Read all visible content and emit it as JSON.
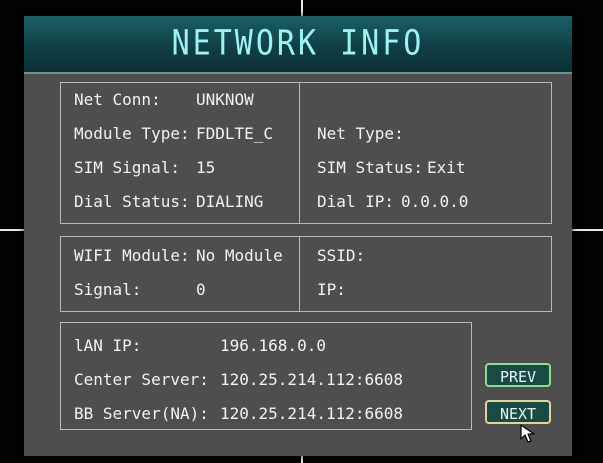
{
  "header": {
    "title": "NETWORK INFO"
  },
  "cellular": {
    "net_conn_label": "Net Conn:",
    "net_conn_value": "UNKNOW",
    "module_type_label": "Module Type:",
    "module_type_value": "FDDLTE_C",
    "sim_signal_label": "SIM Signal:",
    "sim_signal_value": "15",
    "dial_status_label": "Dial Status:",
    "dial_status_value": "DIALING",
    "net_type_label": "Net Type:",
    "net_type_value": "",
    "sim_status_label": "SIM Status:",
    "sim_status_value": "Exit",
    "dial_ip_label": "Dial IP:",
    "dial_ip_value": "0.0.0.0"
  },
  "wifi": {
    "module_label": "WIFI Module:",
    "module_value": "No Module",
    "signal_label": "Signal:",
    "signal_value": "0",
    "ssid_label": "SSID:",
    "ssid_value": "",
    "ip_label": "IP:",
    "ip_value": ""
  },
  "servers": {
    "lan_ip_label": "lAN IP:",
    "lan_ip_value": "196.168.0.0",
    "center_server_label": "Center Server:",
    "center_server_value": "120.25.214.112:6608",
    "bb_server_label": "BB Server(NA):",
    "bb_server_value": "120.25.214.112:6608"
  },
  "buttons": {
    "prev_label": "PREV",
    "next_label": "NEXT"
  },
  "colors": {
    "title_text": "#9ff2f2",
    "title_bar": "#0f3d43",
    "panel": "#4e4e4e",
    "prev_border": "#8fdc8c",
    "next_border": "#e1d49a"
  }
}
